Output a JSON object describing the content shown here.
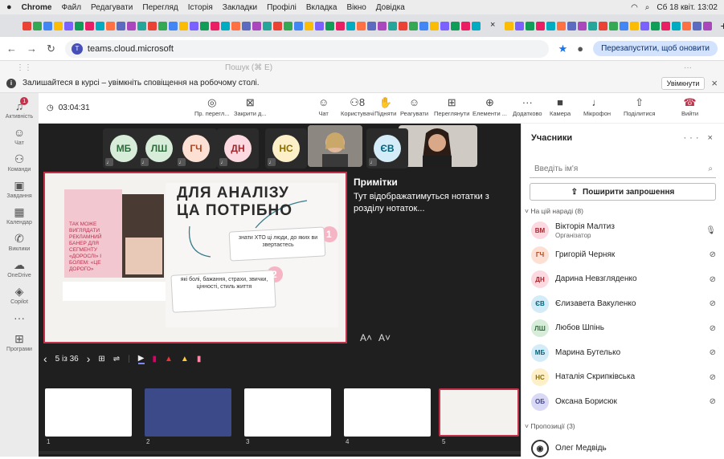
{
  "menubar": {
    "apple": "",
    "app": "Chrome",
    "items": [
      "Файл",
      "Редагувати",
      "Перегляд",
      "Історія",
      "Закладки",
      "Профілі",
      "Вкладка",
      "Вікно",
      "Довідка"
    ],
    "clock": "Сб 18 квіт. 13:02"
  },
  "browser": {
    "url": "teams.cloud.microsoft",
    "restart": "Перезапустити, щоб оновити",
    "new_tab": "+",
    "close_tab": "×"
  },
  "teams_top": {
    "search": "Пошук (⌘ E)",
    "more": "···"
  },
  "notification": {
    "text": "Залишайтеся в курсі – увімкніть сповіщення на робочому столі.",
    "button": "Увімкнути",
    "close": "×"
  },
  "rail": [
    {
      "label": "Активність",
      "icon": "bell-icon",
      "glyph": "♫",
      "badge": "1"
    },
    {
      "label": "Чат",
      "icon": "chat-icon",
      "glyph": "☺"
    },
    {
      "label": "Команди",
      "icon": "teams-icon",
      "glyph": "⚇"
    },
    {
      "label": "Завдання",
      "icon": "tasks-icon",
      "glyph": "▣"
    },
    {
      "label": "Календар",
      "icon": "calendar-icon",
      "glyph": "▦"
    },
    {
      "label": "Виклики",
      "icon": "phone-icon",
      "glyph": "✆"
    },
    {
      "label": "OneDrive",
      "icon": "cloud-icon",
      "glyph": "☁"
    },
    {
      "label": "Copilot",
      "icon": "copilot-icon",
      "glyph": "◈"
    },
    {
      "label": "",
      "icon": "more-icon",
      "glyph": "···"
    },
    {
      "label": "Програми",
      "icon": "apps-icon",
      "glyph": "⊞"
    }
  ],
  "meeting": {
    "timer": "03:04:31",
    "toolbar": [
      {
        "label": "Пр. перегл...",
        "icon": "broadcast-icon",
        "glyph": "◎"
      },
      {
        "label": "Закрити д...",
        "icon": "stop-share-icon",
        "glyph": "⊠"
      },
      {
        "label": "Чат",
        "icon": "chat-icon",
        "glyph": "☺"
      },
      {
        "label": "Користувачі",
        "icon": "people-icon",
        "glyph": "⚇8"
      },
      {
        "label": "Підняти",
        "icon": "hand-icon",
        "glyph": "✋"
      },
      {
        "label": "Реагувати",
        "icon": "react-icon",
        "glyph": "☺"
      },
      {
        "label": "Переглянути",
        "icon": "view-icon",
        "glyph": "⊞"
      },
      {
        "label": "Елементи ...",
        "icon": "apps-icon",
        "glyph": "⊕"
      },
      {
        "label": "Додатково",
        "icon": "more-icon",
        "glyph": "···"
      },
      {
        "label": "Камера",
        "icon": "camera-icon",
        "glyph": "■"
      },
      {
        "label": "Мікрофон",
        "icon": "mic-icon",
        "glyph": "♩"
      },
      {
        "label": "Поділитися",
        "icon": "share-icon",
        "glyph": "⇧"
      },
      {
        "label": "Вийти",
        "icon": "hangup-icon",
        "glyph": "☎"
      }
    ]
  },
  "tiles": [
    {
      "initials": "МБ",
      "bg": "#d7ecd9",
      "fg": "#2e6b3a"
    },
    {
      "initials": "ЛШ",
      "bg": "#d7ecd9",
      "fg": "#2e6b3a"
    },
    {
      "initials": "ГЧ",
      "bg": "#fde0d4",
      "fg": "#b2451d"
    },
    {
      "initials": "ДН",
      "bg": "#fcd9e0",
      "fg": "#a4262c"
    },
    {
      "initials": "НС",
      "bg": "#fdefc7",
      "fg": "#8a6d00"
    },
    {
      "initials": "ЄВ",
      "bg": "#d4ecf7",
      "fg": "#00637c"
    }
  ],
  "slide": {
    "title_line1": "ДЛЯ АНАЛІЗУ",
    "title_line2": "ЦА ПОТРІБНО",
    "left_text": "ТАК МОЖЕ ВИГЛЯДАТИ РЕКЛАМНИЙ БАНЕР ДЛЯ СЕГМЕНТУ «ДОРОСЛІ» І БОЛЕМ: «ЦЕ ДОРОГО»",
    "card1": "знати ХТО ці люди, до яких ви звертаєтесь",
    "card1_num": "1",
    "card2": "які болі, бажання, страхи, звички, цінності, стиль життя",
    "card2_num": "2"
  },
  "notes": {
    "title": "Примітки",
    "text": "Тут відображатимуться нотатки з розділу нотаток...",
    "font_up": "A˄",
    "font_down": "A˅"
  },
  "slidebar": {
    "prev": "‹",
    "counter": "5 із 36",
    "next": "›"
  },
  "thumbs": [
    "1",
    "2",
    "3",
    "4",
    "5"
  ],
  "panel": {
    "title": "Учасники",
    "controls": "··· ×",
    "search_placeholder": "Введіть ім'я",
    "invite": "Поширити запрошення",
    "section_meeting": "На цій нараді (8)",
    "section_suggestions": "Пропозиції (3)",
    "participants": [
      {
        "initials": "ВМ",
        "name": "Вікторія Малтиз",
        "role": "Організатор",
        "bg": "#fcd9e0",
        "fg": "#a4262c",
        "mic": "🎙"
      },
      {
        "initials": "ГЧ",
        "name": "Григорій Черняк",
        "bg": "#fde0d4",
        "fg": "#b2451d",
        "mic": "⊘"
      },
      {
        "initials": "ДН",
        "name": "Дарина Невзгляденко",
        "bg": "#fcd9e0",
        "fg": "#a4262c",
        "mic": "⊘"
      },
      {
        "initials": "ЄВ",
        "name": "Єлизавета Вакуленко",
        "bg": "#d4ecf7",
        "fg": "#00637c",
        "mic": "⊘"
      },
      {
        "initials": "ЛШ",
        "name": "Любов Шпінь",
        "bg": "#d7ecd9",
        "fg": "#2e6b3a",
        "mic": "⊘"
      },
      {
        "initials": "МБ",
        "name": "Марина Бутелько",
        "bg": "#d4ecf7",
        "fg": "#00637c",
        "mic": "⊘"
      },
      {
        "initials": "НС",
        "name": "Наталія Скрипківська",
        "bg": "#fdefc7",
        "fg": "#8a6d00",
        "mic": "⊘"
      },
      {
        "initials": "ОБ",
        "name": "Оксана Борисюк",
        "bg": "#d9d9f6",
        "fg": "#444791",
        "mic": "⊘"
      }
    ],
    "suggestion": {
      "name": "Олег Медвідь"
    }
  }
}
